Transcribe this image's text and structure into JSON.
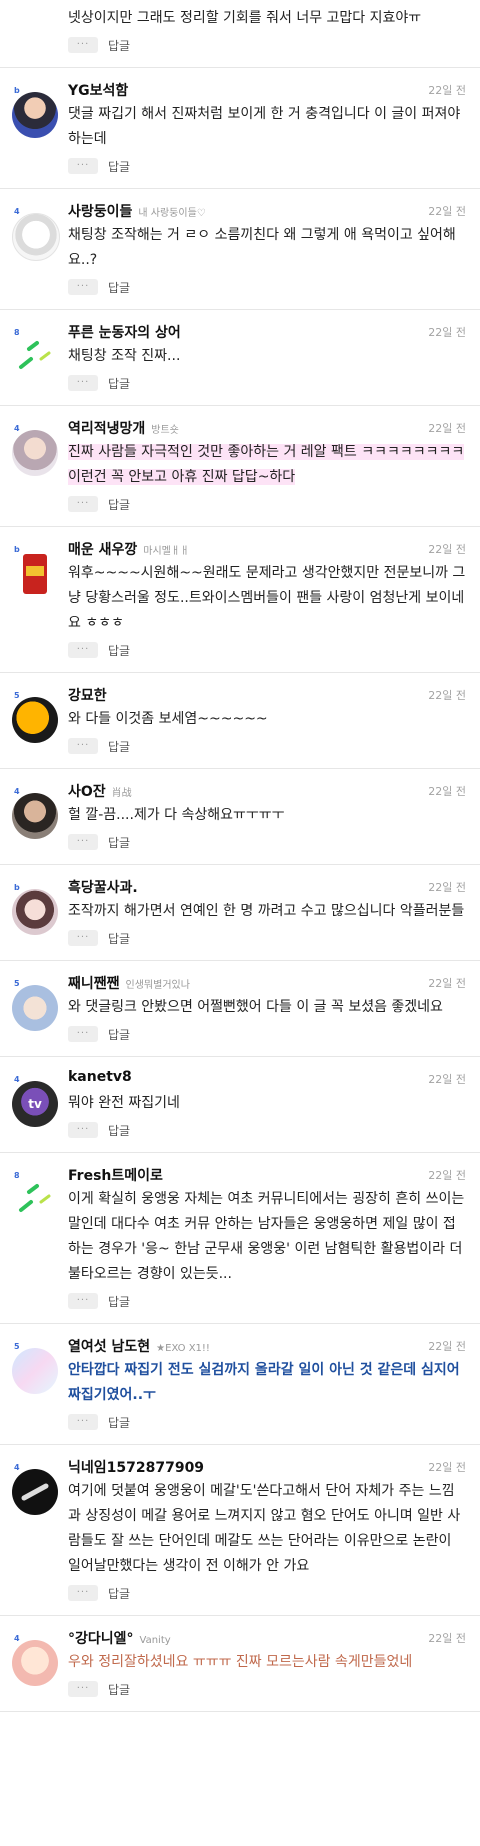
{
  "ui": {
    "reply_label": "답글",
    "more_label": "···"
  },
  "comments": [
    {
      "nick": "",
      "sub": "",
      "date": "",
      "level": "",
      "text": "넷상이지만 그래도 정리할 기회를 줘서 너무 고맙다 지효야ㅠ",
      "avatar": "none",
      "style": ""
    },
    {
      "nick": "YG보석함",
      "sub": "",
      "date": "22일 전",
      "level": "b",
      "text": "댓글 짜깁기 해서 진짜처럼 보이게 한 거 충격입니다 이 글이 퍼져야 하는데",
      "avatar": "yg",
      "style": ""
    },
    {
      "nick": "사랑둥이들",
      "sub": "내 사랑둥이들♡",
      "date": "22일 전",
      "level": "4",
      "text": "채팅창 조작해는 거 ㄹㅇ 소름끼친다 왜 그렇게 애 욕먹이고 싶어해요..?",
      "avatar": "sketch",
      "style": ""
    },
    {
      "nick": "푸른 눈동자의 상어",
      "sub": "",
      "date": "22일 전",
      "level": "8",
      "text": "채팅창 조작 진짜...",
      "avatar": "green",
      "style": ""
    },
    {
      "nick": "역리적냉망개",
      "sub": "방트숏",
      "date": "22일 전",
      "level": "4",
      "text": "진짜 사람들 자극적인 것만 좋아하는 거 레알 팩트 ㅋㅋㅋㅋㅋㅋㅋㅋ이런건 꼭 안보고 아휴 진짜 답답~하다",
      "avatar": "boy",
      "style": "pink"
    },
    {
      "nick": "매운 새우깡",
      "sub": "마시멜ㅐㅐ",
      "date": "22일 전",
      "level": "b",
      "text": "워후~~~~시원해~~원래도 문제라고 생각안했지만 전문보니까 그냥 당황스러울 정도..트와이스멤버들이 팬들 사랑이 엄청난게 보이네요 ㅎㅎㅎ",
      "avatar": "snack",
      "style": ""
    },
    {
      "nick": "강묘한",
      "sub": "",
      "date": "22일 전",
      "level": "5",
      "text": "와 다들 이것좀 보세염~~~~~~",
      "avatar": "orange",
      "style": ""
    },
    {
      "nick": "사O잔",
      "sub": "肖战",
      "date": "22일 전",
      "level": "4",
      "text": "헐 깔-끔....제가 다 속상해요ㅠㅜㅠㅜ",
      "avatar": "man",
      "style": ""
    },
    {
      "nick": "흑당꿀사과.",
      "sub": "",
      "date": "22일 전",
      "level": "b",
      "text": "조작까지 해가면서 연예인 한 명 까려고 수고 많으십니다 악플러분들",
      "avatar": "girl",
      "style": ""
    },
    {
      "nick": "째니짼짼",
      "sub": "인생뭐별거있나",
      "date": "22일 전",
      "level": "5",
      "text": "와 댓글링크 안봤으면 어쩔뻔했어 다들 이 글 꼭 보셨음 좋겠네요",
      "avatar": "kids",
      "style": ""
    },
    {
      "nick": "kanetv8",
      "sub": "",
      "date": "22일 전",
      "level": "4",
      "text": "뭐야 완전 짜집기네",
      "avatar": "kane",
      "style": ""
    },
    {
      "nick": "Fresh트메이로",
      "sub": "",
      "date": "22일 전",
      "level": "8",
      "text": "이게 확실히 웅앵웅 자체는 여초 커뮤니티에서는 굉장히 흔히 쓰이는 말인데 대다수 여초 커뮤 안하는 남자들은 웅앵웅하면 제일 많이 접하는 경우가 '응~ 한남 군무새 웅앵웅' 이런 남혐틱한 활용법이라 더 불타오르는 경향이 있는듯...",
      "avatar": "green",
      "style": ""
    },
    {
      "nick": "열여섯 남도현",
      "sub": "★EXO X1!!",
      "date": "22일 전",
      "level": "5",
      "text": "안타깝다 짜집기 전도 실검까지 올라갈 일이 아닌 것 같은데 심지어 짜집기였어..ㅜ",
      "avatar": "holo",
      "style": "blue"
    },
    {
      "nick": "닉네임1572877909",
      "sub": "",
      "date": "22일 전",
      "level": "4",
      "text": "여기에 덧붙여 웅앵웅이 메갈'도'쓴다고해서 단어 자체가 주는 느낌과 상징성이 메갈 용어로 느껴지지 않고 혐오 단어도 아니며 일반 사람들도 잘 쓰는 단어인데 메갈도 쓰는 단어라는 이유만으로 논란이 일어날만했다는 생각이 전 이해가 안 가요",
      "avatar": "black",
      "style": ""
    },
    {
      "nick": "°강다니엘°",
      "sub": "Vanity",
      "date": "22일 전",
      "level": "4",
      "text": "우와 정리잘하셨네요 ㅠㅠㅠ 진짜 모르는사람 속게만들었네",
      "avatar": "peach",
      "style": "brown"
    }
  ]
}
